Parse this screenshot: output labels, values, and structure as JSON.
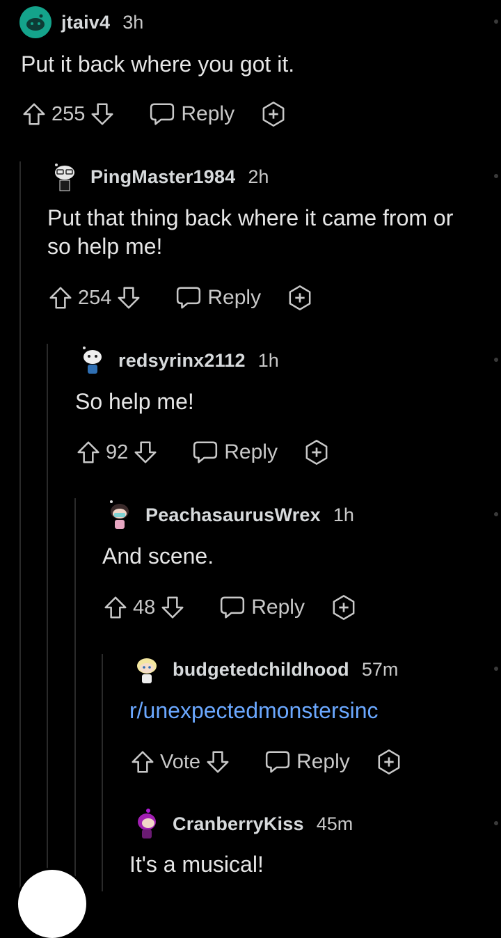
{
  "comments": [
    {
      "user": "jtaiv4",
      "time": "3h",
      "text": "Put it back where you got it.",
      "votes": "255",
      "reply": "Reply"
    },
    {
      "user": "PingMaster1984",
      "time": "2h",
      "text_line1": "Put that thing back where it came from or",
      "text_line2": "so help me!",
      "votes": "254",
      "reply": "Reply"
    },
    {
      "user": "redsyrinx2112",
      "time": "1h",
      "text": "So help me!",
      "votes": "92",
      "reply": "Reply"
    },
    {
      "user": "PeachasaurusWrex",
      "time": "1h",
      "text": "And scene.",
      "votes": "48",
      "reply": "Reply"
    },
    {
      "user": "budgetedchildhood",
      "time": "57m",
      "text": "r/unexpectedmonstersinc",
      "votes": "Vote",
      "reply": "Reply"
    },
    {
      "user": "CranberryKiss",
      "time": "45m",
      "text": "It's a musical!"
    }
  ],
  "colors": {
    "background": "#000000",
    "text": "#d7dadc",
    "link": "#6ba8ff",
    "thread_line": "#2a2a2a"
  }
}
